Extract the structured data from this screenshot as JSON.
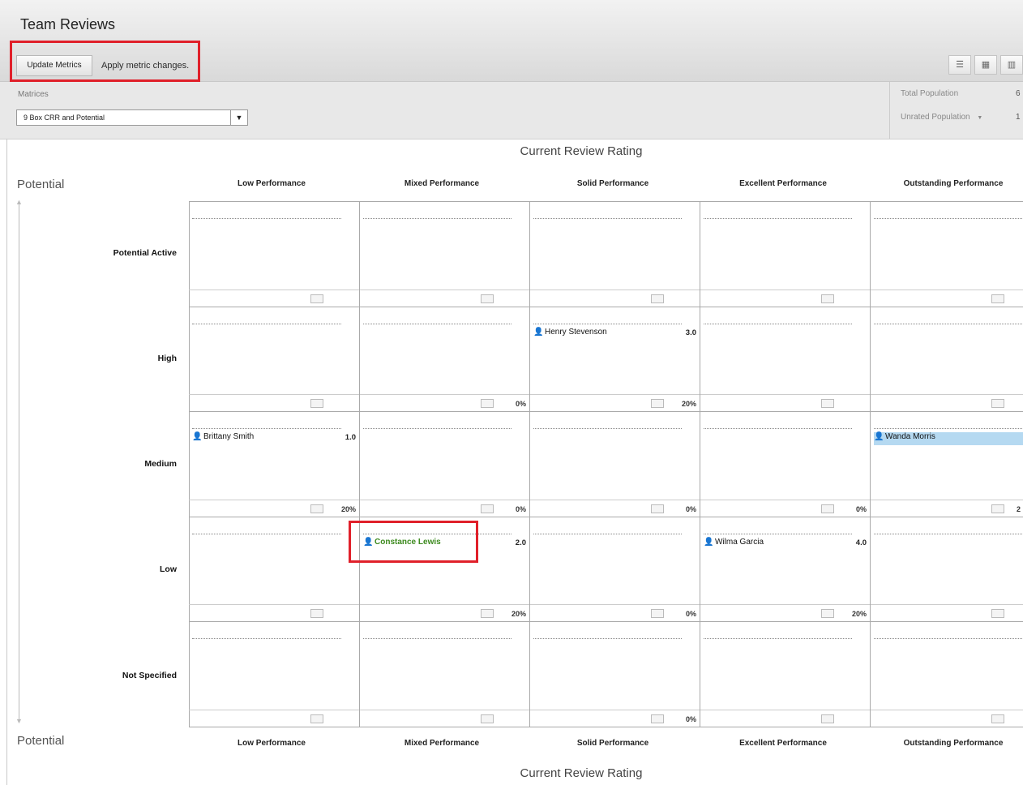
{
  "header": {
    "title": "Team Reviews",
    "update_button": "Update Metrics",
    "apply_text": "Apply metric changes."
  },
  "metrics": {
    "label": "Matrices",
    "selected": "9 Box CRR and Potential",
    "total_population_label": "Total Population",
    "total_population_value": "6",
    "unrated_population_label": "Unrated Population",
    "unrated_population_value": "1"
  },
  "axes": {
    "x_title": "Current Review Rating",
    "y_title": "Potential"
  },
  "columns": [
    "Low Performance",
    "Mixed Performance",
    "Solid Performance",
    "Excellent Performance",
    "Outstanding Performance"
  ],
  "rows": [
    "Potential Active",
    "High",
    "Medium",
    "Low",
    "Not Specified"
  ],
  "cells": {
    "r1": {
      "c1": "",
      "c2": "0%",
      "c3": "20%",
      "c4": "",
      "c5": ""
    },
    "r2": {
      "c1": "20%",
      "c2": "0%",
      "c3": "0%",
      "c4": "0%",
      "c5": "2"
    },
    "r3": {
      "c1": "",
      "c2": "20%",
      "c3": "0%",
      "c4": "20%",
      "c5": ""
    },
    "r4": {
      "c1": "",
      "c2": "",
      "c3": "0%",
      "c4": "",
      "c5": ""
    }
  },
  "employees": {
    "henry": {
      "name": "Henry Stevenson",
      "score": "3.0"
    },
    "brittany": {
      "name": "Brittany Smith",
      "score": "1.0"
    },
    "wanda": {
      "name": "Wanda Morris",
      "score": ""
    },
    "constance": {
      "name": "Constance Lewis",
      "score": "2.0"
    },
    "wilma": {
      "name": "Wilma Garcia",
      "score": "4.0"
    }
  },
  "colors": {
    "highlight": "#e0202a",
    "selected_row": "#b5d9f1",
    "green_name": "#3c8a1e",
    "person_icon": "#4a7fc8"
  }
}
